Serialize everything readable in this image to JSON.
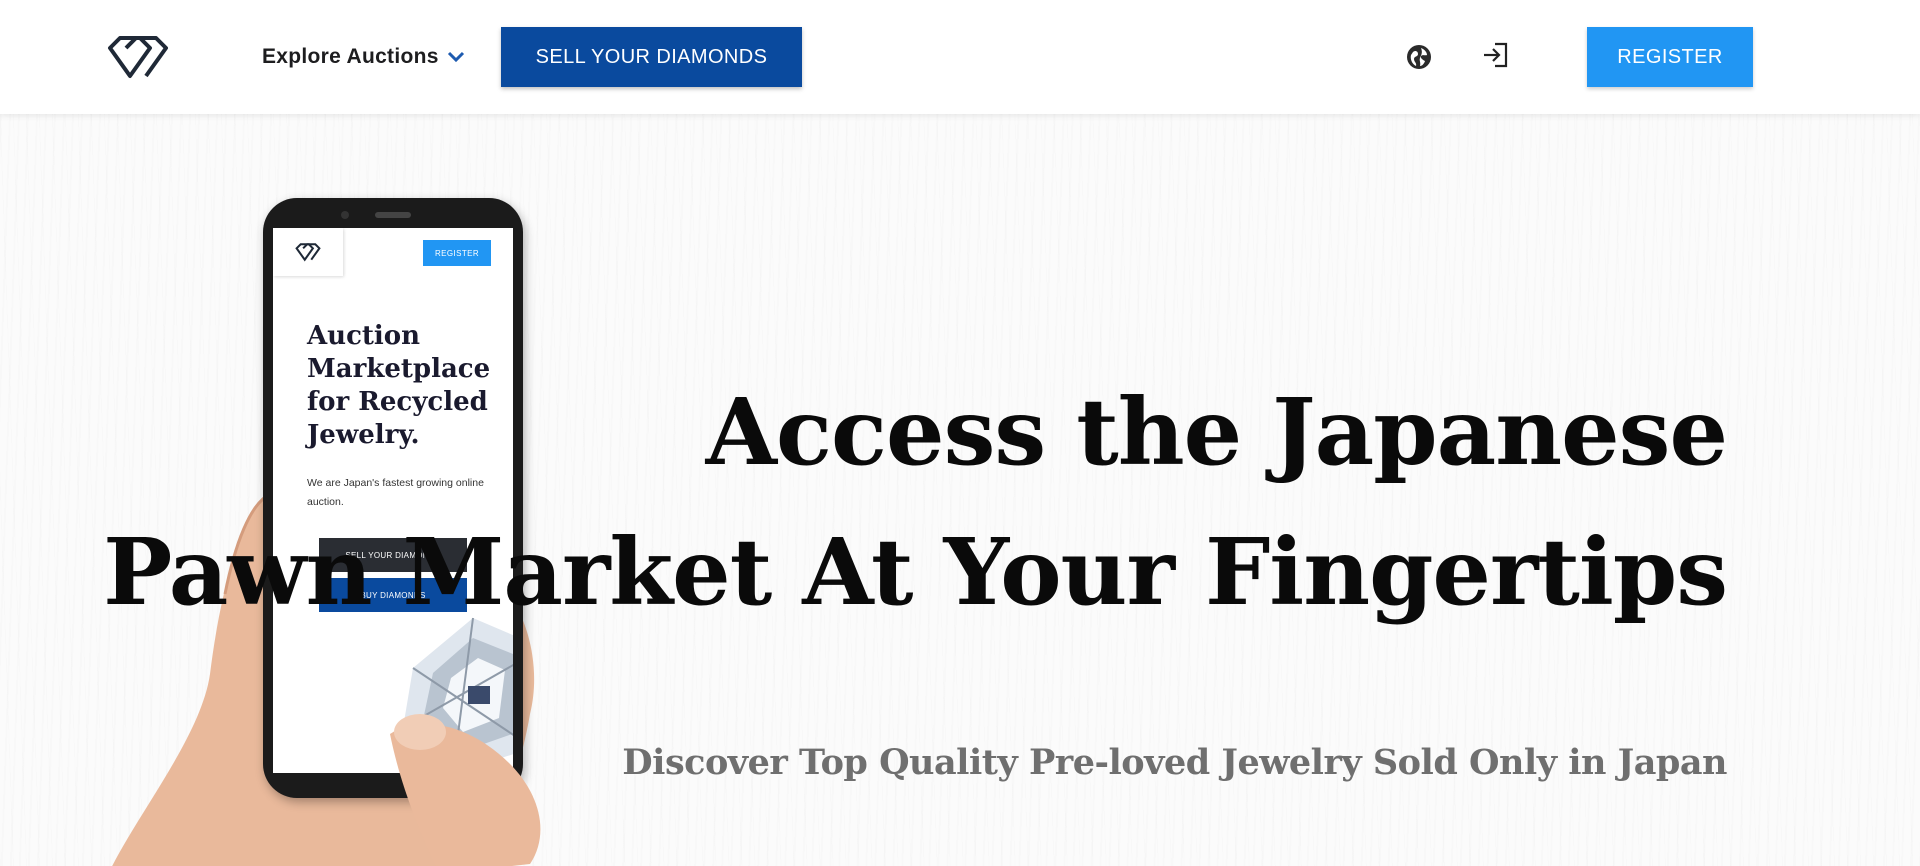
{
  "header": {
    "logo_icon": "diamond-logo-icon",
    "explore_label": "Explore Auctions",
    "sell_label": "SELL YOUR DIAMONDS",
    "globe_icon": "globe-icon",
    "login_icon": "login-icon",
    "register_label": "REGISTER"
  },
  "hero": {
    "headline_line1": "Access the Japanese",
    "headline_line2": "Pawn Market At Your Fingertips",
    "subheadline": "Discover Top Quality Pre-loved Jewelry Sold Only in Japan",
    "phone_mockup": {
      "register_label": "REGISTER",
      "title": "Auction Marketplace for Recycled Jewelry.",
      "subtitle": "We are Japan's fastest growing online auction.",
      "sell_label": "SELL YOUR DIAMONDS",
      "buy_label": "BUY DIAMONDS"
    }
  },
  "colors": {
    "sell_button": "#0a4a9e",
    "register_button": "#2196f3",
    "headline": "#0a0a0a",
    "subheadline": "#6f6f6f"
  }
}
